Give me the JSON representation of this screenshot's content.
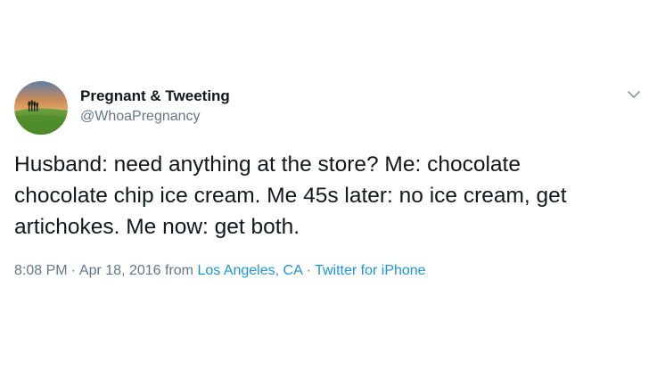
{
  "tweet": {
    "avatar_icon": "profile-photo-landscape-icon",
    "display_name": "Pregnant & Tweeting",
    "handle": "@WhoaPregnancy",
    "menu_icon": "chevron-down-icon",
    "text_lines": [
      "Husband: need anything at the store? Me: chocolate",
      "chocolate chip ice cream. Me 45s later: no ice cream, get",
      "artichokes. Me now: get both."
    ],
    "time": "8:08 PM",
    "separator": "·",
    "date": "Apr 18, 2016",
    "from_word": "from",
    "location": "Los Angeles, CA",
    "source": "Twitter for iPhone"
  },
  "colors": {
    "text_primary": "#14171a",
    "text_secondary": "#657786",
    "link": "#1b95e0",
    "background": "#ffffff"
  }
}
